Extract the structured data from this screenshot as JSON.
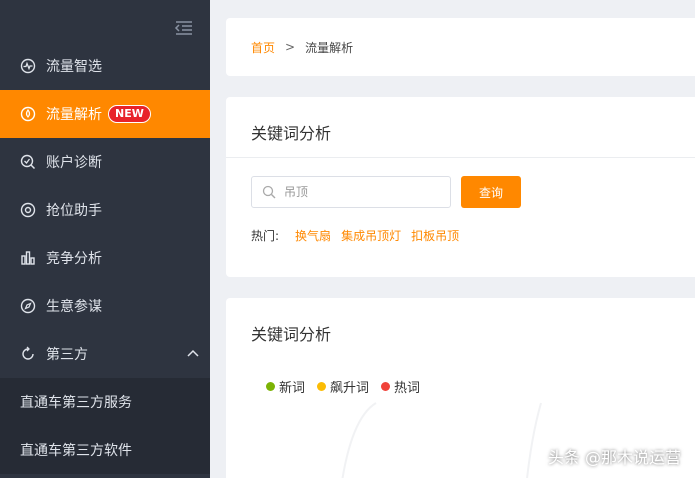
{
  "sidebar": {
    "items": [
      {
        "label": "流量智选",
        "icon": "pulse-icon"
      },
      {
        "label": "流量解析",
        "icon": "droplet-icon",
        "badge": "NEW"
      },
      {
        "label": "账户诊断",
        "icon": "diagnosis-icon"
      },
      {
        "label": "抢位助手",
        "icon": "target-icon"
      },
      {
        "label": "竞争分析",
        "icon": "bar-chart-icon"
      },
      {
        "label": "生意参谋",
        "icon": "compass-icon"
      },
      {
        "label": "第三方",
        "icon": "refresh-icon"
      }
    ],
    "sub_items": [
      "直通车第三方服务",
      "直通车第三方软件"
    ]
  },
  "breadcrumb": {
    "home": "首页",
    "sep": ">",
    "current": "流量解析"
  },
  "search": {
    "title": "关键词分析",
    "placeholder": "吊顶",
    "button": "查询",
    "hot_label": "热门:",
    "hot_tags": [
      "换气扇",
      "集成吊顶灯",
      "扣板吊顶"
    ]
  },
  "analysis": {
    "title": "关键词分析",
    "legend": [
      {
        "label": "新词",
        "color": "#7cb305"
      },
      {
        "label": "飙升词",
        "color": "#fbbc05"
      },
      {
        "label": "热词",
        "color": "#f0433a"
      }
    ]
  },
  "watermark": "头条 @那木说运营",
  "colors": {
    "accent": "#ff8800",
    "sidebar": "#2e3440",
    "badge": "#e8232a"
  }
}
